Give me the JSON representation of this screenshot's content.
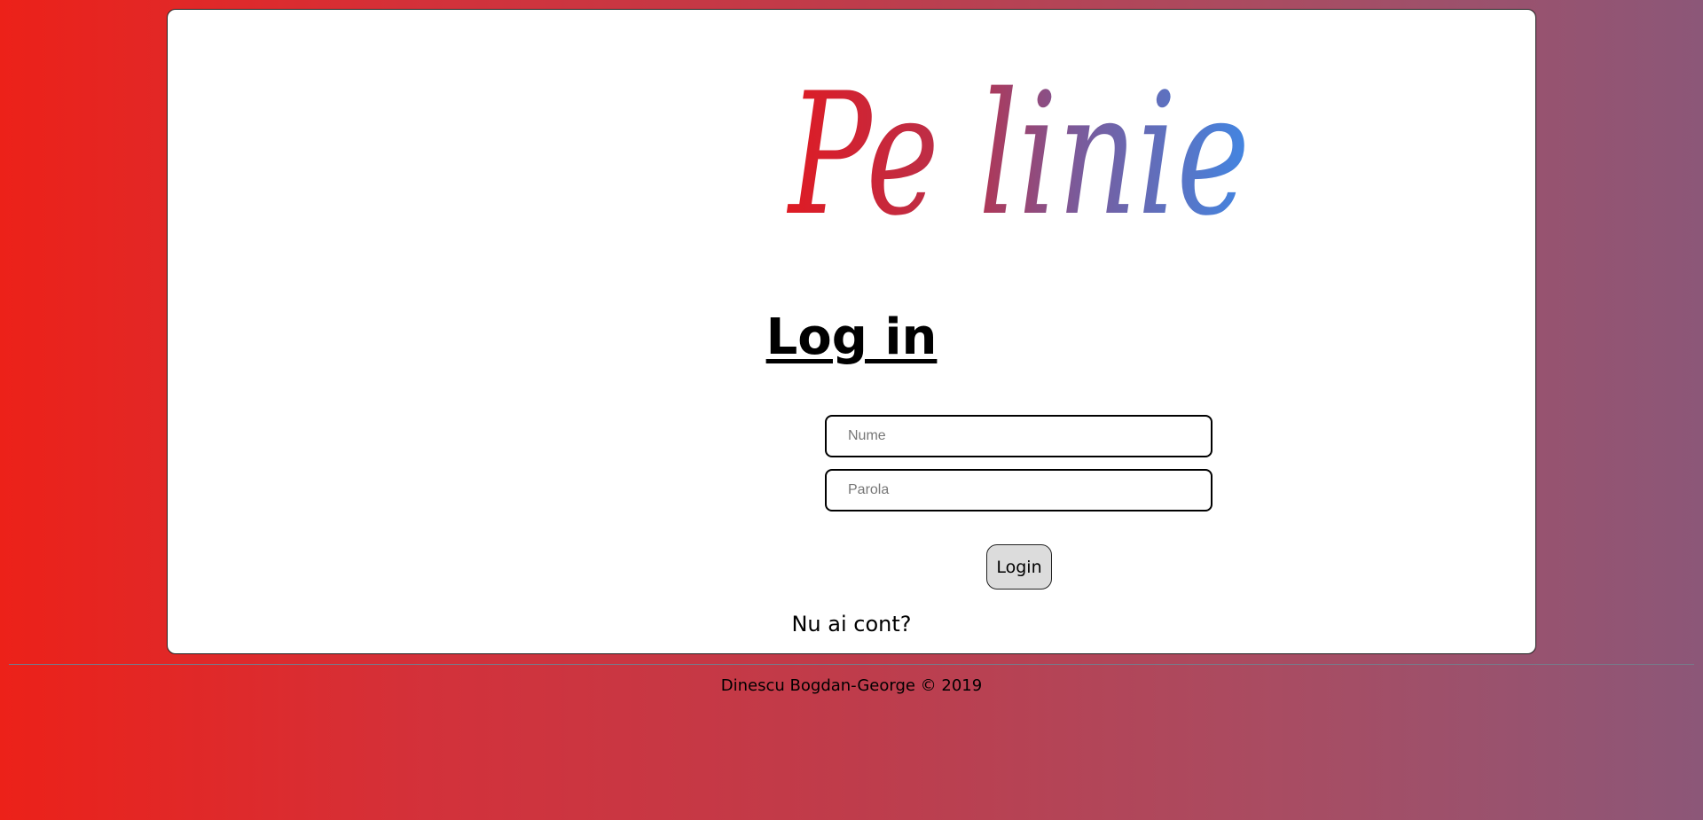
{
  "brand": {
    "logo_text": "Pe linie"
  },
  "login_form": {
    "title": "Log in",
    "username_placeholder": "Nume",
    "password_placeholder": "Parola",
    "submit_label": "Login",
    "signup_prompt": "Nu ai cont?"
  },
  "footer": {
    "copyright": "Dinescu Bogdan-George © 2019"
  },
  "colors": {
    "background_left": "#ec2119",
    "background_right": "#8c5778",
    "logo_red": "#e01a22",
    "logo_purple": "#7b5a9a",
    "logo_blue": "#3f88e6",
    "card": "#ffffff",
    "button": "#dcdcdc"
  }
}
